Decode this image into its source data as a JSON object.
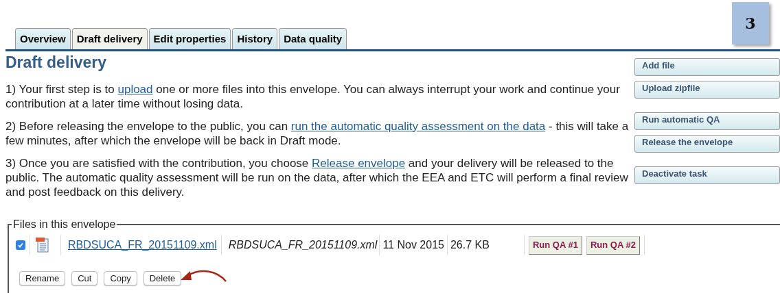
{
  "step_badge": "3",
  "tabs": [
    {
      "label": "Overview",
      "selected": false
    },
    {
      "label": "Draft delivery",
      "selected": true
    },
    {
      "label": "Edit properties",
      "selected": false
    },
    {
      "label": "History",
      "selected": false
    },
    {
      "label": "Data quality",
      "selected": false
    }
  ],
  "heading": "Draft delivery",
  "paragraphs": [
    {
      "before": "1) Your first step is to ",
      "link": "upload",
      "after": " one or more files into this envelope. You can always interrupt your work and continue your contribution at a later time without losing data."
    },
    {
      "before": "2) Before releasing the envelope to the public, you can ",
      "link": "run the automatic quality assessment on the data",
      "after": " - this will take a few minutes, after which the envelope will be back in Draft mode."
    },
    {
      "before": "3) Once you are satisfied with the contribution, you choose ",
      "link": "Release envelope",
      "after": " and your delivery will be released to the public. The automatic quality assessment will be run on the data, after which the EEA and ETC will perform a final review and post feedback on this delivery."
    }
  ],
  "action_groups": [
    [
      "Add file",
      "Upload zipfile"
    ],
    [
      "Run automatic QA",
      "Release the envelope"
    ],
    [
      "Deactivate task"
    ]
  ],
  "files": {
    "legend": "Files in this envelope",
    "rows": [
      {
        "checked": true,
        "name": "RBDSUCA_FR_20151109.xml",
        "title": "RBDSUCA_FR_20151109.xml",
        "date": "11 Nov 2015",
        "size": "26.7 KB",
        "qa_buttons": [
          "Run QA #1",
          "Run QA #2"
        ]
      }
    ],
    "buttons": [
      "Rename",
      "Cut",
      "Copy",
      "Delete"
    ]
  }
}
